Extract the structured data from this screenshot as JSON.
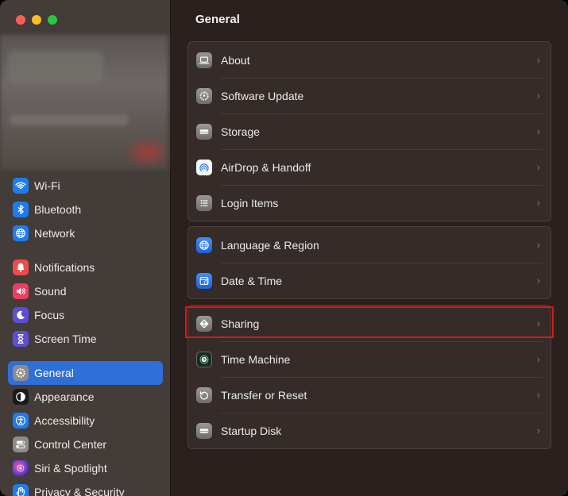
{
  "window": {
    "traffic_lights": [
      "close",
      "minimize",
      "zoom"
    ]
  },
  "sidebar": {
    "groups": [
      [
        {
          "label": "Wi-Fi",
          "icon": "wifi-icon",
          "color": "#1e7cf2"
        },
        {
          "label": "Bluetooth",
          "icon": "bluetooth-icon",
          "color": "#1e7cf2"
        },
        {
          "label": "Network",
          "icon": "globe-icon",
          "color": "#1e7cf2"
        }
      ],
      [
        {
          "label": "Notifications",
          "icon": "bell-icon",
          "color": "#ee4b4b"
        },
        {
          "label": "Sound",
          "icon": "speaker-icon",
          "color": "#ee3d62"
        },
        {
          "label": "Focus",
          "icon": "moon-icon",
          "color": "#5b4fd6"
        },
        {
          "label": "Screen Time",
          "icon": "hourglass-icon",
          "color": "#5b4fd6"
        }
      ],
      [
        {
          "label": "General",
          "icon": "gear-icon",
          "color": "#8e8c8a",
          "active": true
        },
        {
          "label": "Appearance",
          "icon": "appearance-icon",
          "color": "#1a1a1a"
        },
        {
          "label": "Accessibility",
          "icon": "accessibility-icon",
          "color": "#1e7cf2"
        },
        {
          "label": "Control Center",
          "icon": "control-center-icon",
          "color": "#8e8c8a"
        },
        {
          "label": "Siri & Spotlight",
          "icon": "siri-icon",
          "color": "#6a3fd0"
        },
        {
          "label": "Privacy & Security",
          "icon": "hand-icon",
          "color": "#1e7cf2"
        }
      ]
    ]
  },
  "main": {
    "title": "General",
    "sections": [
      [
        {
          "label": "About",
          "icon": "laptop-icon"
        },
        {
          "label": "Software Update",
          "icon": "software-update-icon"
        },
        {
          "label": "Storage",
          "icon": "storage-icon"
        },
        {
          "label": "AirDrop & Handoff",
          "icon": "airdrop-icon"
        },
        {
          "label": "Login Items",
          "icon": "login-items-icon"
        }
      ],
      [
        {
          "label": "Language & Region",
          "icon": "globe-icon"
        },
        {
          "label": "Date & Time",
          "icon": "calendar-icon"
        }
      ],
      [
        {
          "label": "Sharing",
          "icon": "sharing-icon",
          "highlighted": true
        },
        {
          "label": "Time Machine",
          "icon": "time-machine-icon"
        },
        {
          "label": "Transfer or Reset",
          "icon": "reset-icon"
        },
        {
          "label": "Startup Disk",
          "icon": "startup-disk-icon"
        }
      ]
    ]
  },
  "chevron": "›"
}
